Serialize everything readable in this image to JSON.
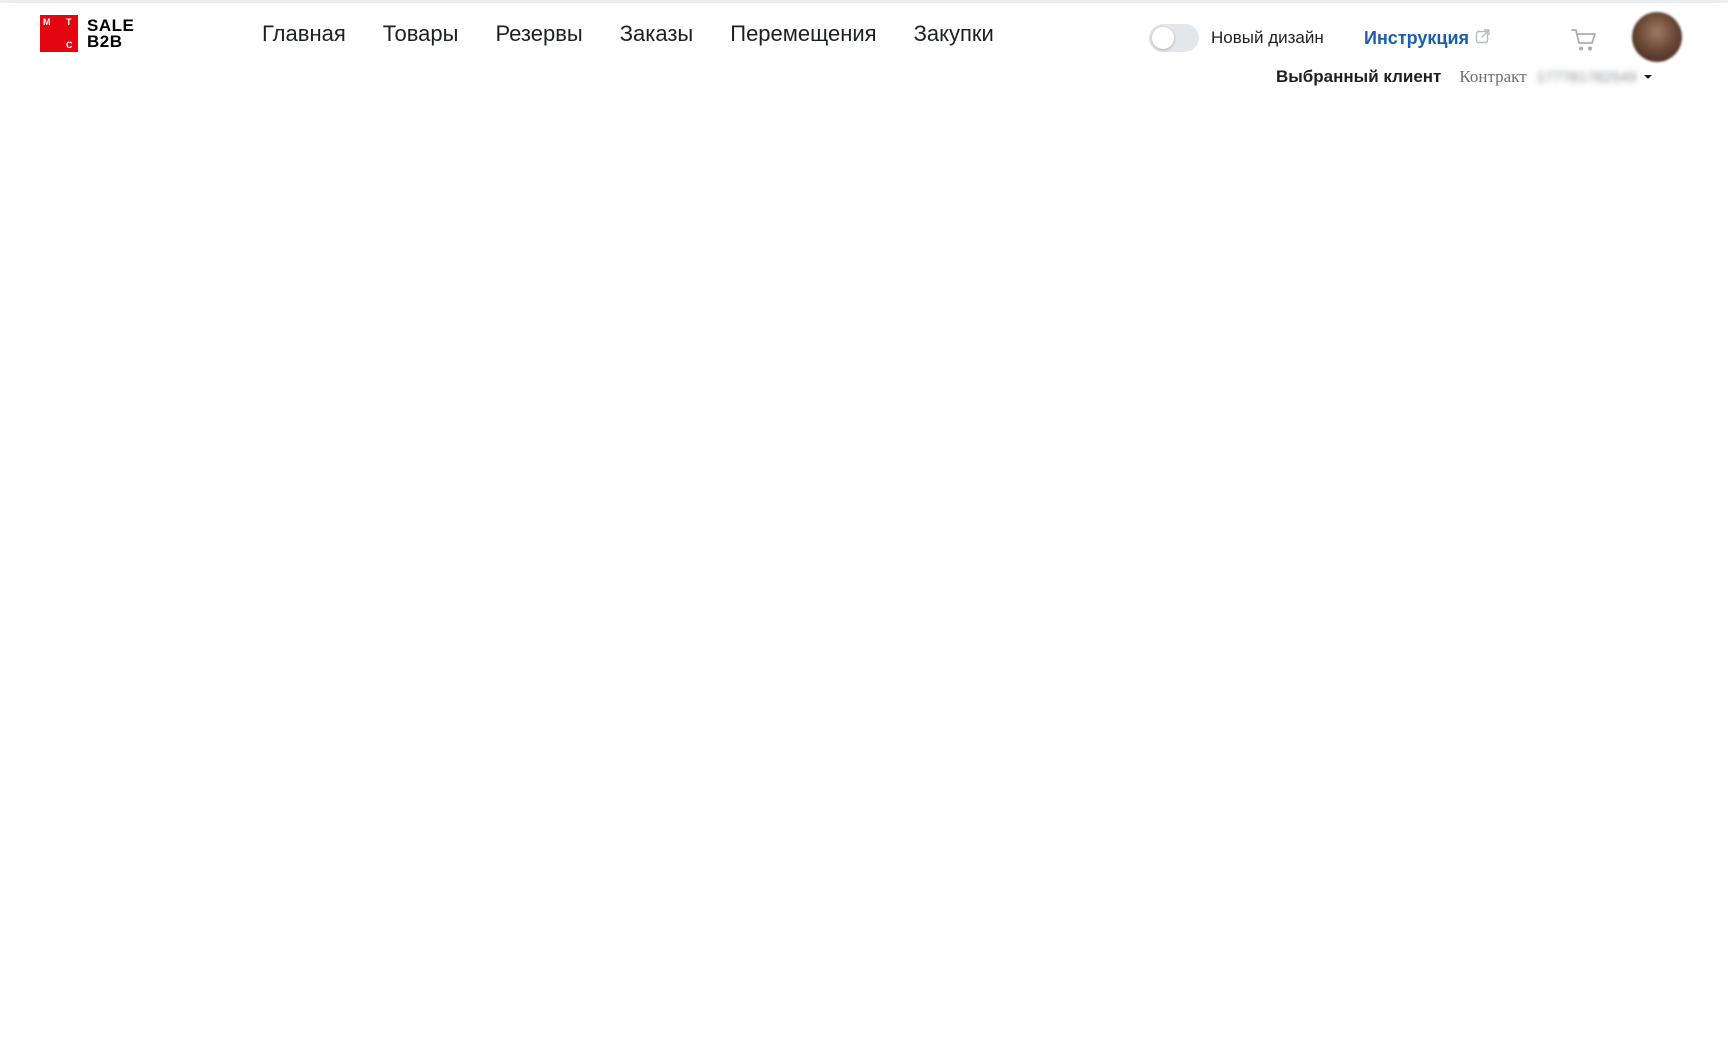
{
  "brand": {
    "mark_letters": [
      "М",
      "Т",
      "С"
    ],
    "line1": "SALE",
    "line2": "B2B",
    "color": "#e30611"
  },
  "nav": {
    "items": [
      {
        "label": "Главная"
      },
      {
        "label": "Товары"
      },
      {
        "label": "Резервы"
      },
      {
        "label": "Заказы"
      },
      {
        "label": "Перемещения"
      },
      {
        "label": "Закупки"
      }
    ]
  },
  "design_toggle": {
    "label": "Новый дизайн",
    "on": false
  },
  "instruction": {
    "label": "Инструкция",
    "icon": "external-link-icon",
    "color": "#1b5eab"
  },
  "cart": {
    "icon": "cart-icon"
  },
  "user": {
    "icon": "avatar"
  },
  "client": {
    "label": "Выбранный клиент",
    "contract_label": "Контракт",
    "contract_value": "177781782549",
    "icon": "caret-down-icon"
  }
}
